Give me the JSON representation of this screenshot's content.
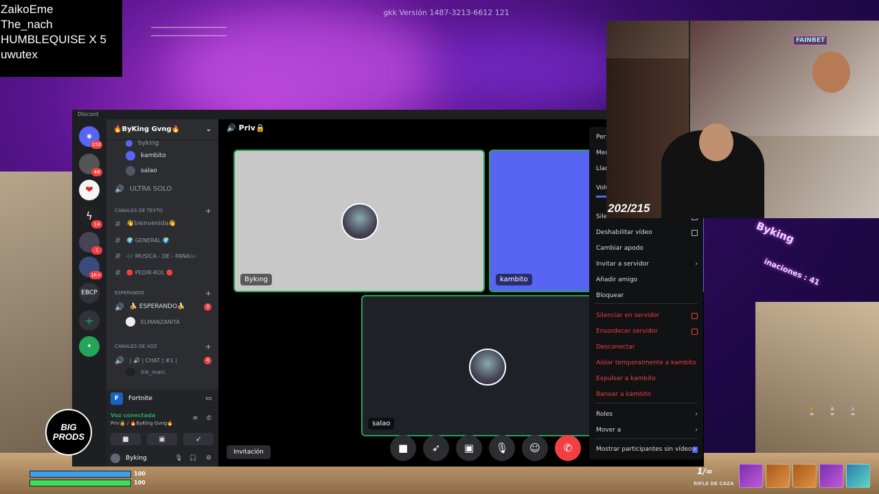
{
  "stream_overlay": {
    "viewer_names": [
      "ZaikoEme",
      "The_nach",
      "HUMBLEQUISE X 5",
      "uwutex"
    ],
    "game_version": "gkk  Versión 1487-3213-6612 121",
    "viewer_counter": "202/215",
    "neon_sign": "FAINBET",
    "logo_text": [
      "BIG",
      "PRODS"
    ],
    "sign_text": "Byking",
    "sign_sub": "inaciones : 41"
  },
  "discord": {
    "titlebar": "Discord",
    "guild_badges": {
      "g1": "150",
      "g2": "48",
      "g4": "14",
      "g5": "1",
      "g6": "1K+"
    },
    "guild_text": {
      "ebcp": "EBCP"
    },
    "server_name": "🔥ByKing Gvng🔥",
    "channels": {
      "voice_member_top": "byking",
      "voice_member_2": "kambito",
      "voice_member_3": "salao",
      "ultra_solo": "ULTRA SOLO",
      "cat_text": "CANALES DE TEXTO",
      "bienvenida": "👋bienvenida👋",
      "general": "🌍 GENERAL 🌍",
      "musica": "🎶 MUSICA - DE - PANA🎶",
      "pedir_rol": "🔴 PEDIR-ROL 🔴",
      "cat_esperando": "ESPERANDO",
      "esperando": "🍌 ESPERANDO🍌",
      "esperando_badge": "3",
      "elmanzanita": "ELMANZANITA",
      "cat_voz": "CANALES DE VOZ",
      "chat1": "| 🔊 | CHAT | #1 |",
      "chat1_badge": "4",
      "cut_member": "lnk_marc"
    },
    "activity": "Fortnite",
    "voice_status": "Voz conectada",
    "voice_channel": "Priv🔒 / 🔥ByKing Gvng🔥",
    "username": "Byking",
    "channel_header": "Priv🔒",
    "tiles": {
      "byking": "Bykıng",
      "kambito": "kambito",
      "salao": "salao"
    },
    "invite_button": "Invitación",
    "context_menu": {
      "perfil": "Perfil",
      "mencionar": "Mencionar",
      "llamar": "Llamar",
      "volumen": "Volumen",
      "silenciar": "Silenciar",
      "deshabilitar_video": "Deshabilitar vídeo",
      "cambiar_apodo": "Cambiar apodo",
      "invitar_servidor": "Invitar a servidor",
      "anadir_amigo": "Añadir amigo",
      "bloquear": "Bloquear",
      "silenciar_servidor": "Silenciar en servidor",
      "ensordecer_servidor": "Ensordecer servidor",
      "desconectar": "Desconectar",
      "aislar": "Aislar temporalmente a kambito",
      "expulsar": "Expulsar a kambito",
      "banear": "Banear a kambito",
      "roles": "Roles",
      "mover": "Mover a",
      "mostrar_participantes": "Mostrar participantes sin vídeo"
    }
  },
  "game_hud": {
    "health": "100",
    "shield": "100",
    "health_level": 1.0,
    "shield_level": 1.0,
    "ammo": "1/∞",
    "weapon_name": "RIFLE DE CAZA",
    "materials": [
      "∞",
      "∞",
      "∞"
    ]
  },
  "colors": {
    "discord_blurple": "#5865f2",
    "danger": "#f23f43",
    "online": "#23a55a"
  }
}
